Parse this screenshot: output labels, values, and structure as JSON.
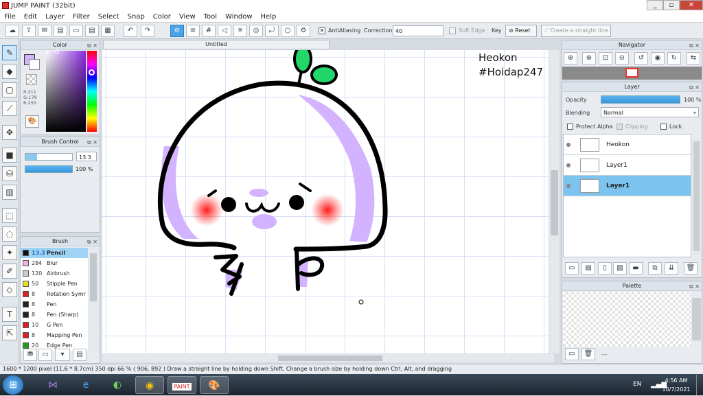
{
  "window": {
    "title": "JUMP PAINT (32bit)"
  },
  "menu": [
    "File",
    "Edit",
    "Layer",
    "Filter",
    "Select",
    "Snap",
    "Color",
    "View",
    "Tool",
    "Window",
    "Help"
  ],
  "toolbar": {
    "antialiasing_label": "AntiAliasing",
    "correction_label": "Correction",
    "correction_value": "40",
    "soft_edge_label": "Soft Edge",
    "key_label": "Key",
    "reset_label": "Reset",
    "straight_line_label": "Create a straight line"
  },
  "color_panel": {
    "title": "Color",
    "r": "R:211",
    "g": "G:179",
    "b": "B:255",
    "current_color": "#d3b3ff"
  },
  "brush_control": {
    "title": "Brush Control",
    "size": "13.3",
    "opacity": "100 %"
  },
  "brush_panel": {
    "title": "Brush",
    "items": [
      {
        "size": "13.3",
        "name": "Pencil",
        "color": "#111111",
        "selected": true
      },
      {
        "size": "284",
        "name": "Blur",
        "color": "#f5b0e8",
        "selected": false
      },
      {
        "size": "120",
        "name": "Airbrush",
        "color": "#cccccc",
        "selected": false
      },
      {
        "size": "50",
        "name": "Stipple Pen",
        "color": "#e8e020",
        "selected": false
      },
      {
        "size": "8",
        "name": "Rotation Symr",
        "color": "#e02020",
        "selected": false
      },
      {
        "size": "8",
        "name": "Pen",
        "color": "#222222",
        "selected": false
      },
      {
        "size": "8",
        "name": "Pen (Sharp)",
        "color": "#222222",
        "selected": false
      },
      {
        "size": "10",
        "name": "G Pen",
        "color": "#e02020",
        "selected": false
      },
      {
        "size": "8",
        "name": "Mapping Pen",
        "color": "#e02020",
        "selected": false
      },
      {
        "size": "20",
        "name": "Edge Pen",
        "color": "#20a020",
        "selected": false
      }
    ]
  },
  "canvas": {
    "tab_title": "Untitled",
    "text_line1": "Heokon",
    "text_line2": "#Hoidap247"
  },
  "navigator": {
    "title": "Navigator"
  },
  "layer_panel": {
    "title": "Layer",
    "opacity_label": "Opacity",
    "opacity_value": "100 %",
    "opacity_fraction": 1.0,
    "blending_label": "Blending",
    "blending_value": "Normal",
    "protect_alpha_label": "Protect Alpha",
    "clipping_label": "Clipping",
    "lock_label": "Lock",
    "layers": [
      {
        "name": "Heokon",
        "selected": false
      },
      {
        "name": "Layer1",
        "selected": false
      },
      {
        "name": "Layer1",
        "selected": true
      }
    ]
  },
  "palette_panel": {
    "title": "Palette",
    "footer_text": "---"
  },
  "status": {
    "text": "1600 * 1200 pixel   (11.6 * 8.7cm)   350 dpi   66 %   ( 906, 892 )   Draw a straight line by holding down Shift, Change a brush size by holding down Ctrl, Alt, and dragging"
  },
  "taskbar": {
    "lang": "EN",
    "time": "4:56 AM",
    "date": "10/7/2021"
  }
}
